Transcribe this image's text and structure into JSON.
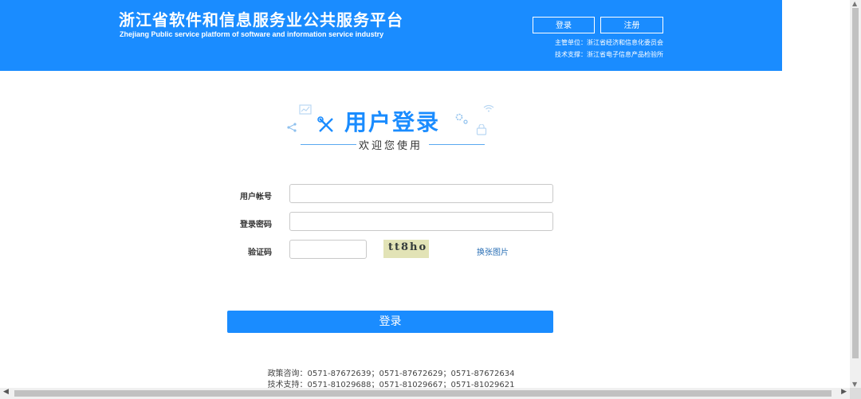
{
  "header": {
    "title": "浙江省软件和信息服务业公共服务平台",
    "subtitle": "Zhejiang Public service platform of software and information service industry",
    "login_label": "登录",
    "register_label": "注册",
    "organizer": "主管单位：浙江省经济和信息化委员会",
    "support": "技术支撑：浙江省电子信息产品检验所"
  },
  "login": {
    "title": "用户登录",
    "welcome": "欢迎您使用",
    "account_label": "用户帐号",
    "account_value": "",
    "password_label": "登录密码",
    "password_value": "",
    "captcha_label": "验证码",
    "captcha_value": "",
    "captcha_text": "tt8ho",
    "refresh_label": "换张图片",
    "submit_label": "登录"
  },
  "footer": {
    "policy": "政策咨询：0571-87672639；0571-87672629；0571-87672634",
    "tech": "技术支持：0571-81029688；0571-81029667；0571-81029621"
  },
  "colors": {
    "brand": "#1a8cff",
    "link": "#2a6fb5"
  },
  "icons": [
    "chart-icon",
    "tools-icon",
    "share-icon",
    "gear-icon",
    "wifi-icon",
    "lock-icon"
  ]
}
